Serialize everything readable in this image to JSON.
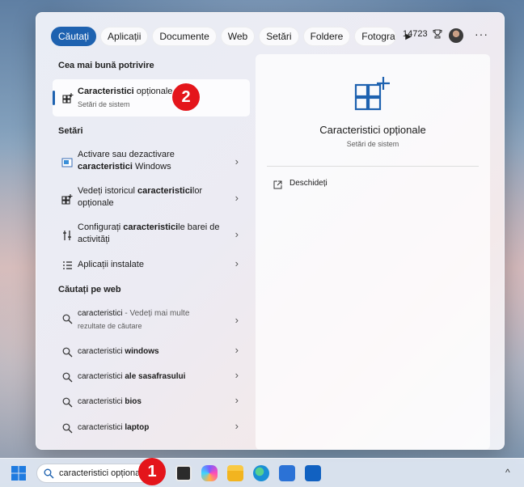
{
  "filters": {
    "tabs": [
      "Căutați",
      "Aplicații",
      "Documente",
      "Web",
      "Setări",
      "Foldere",
      "Fotograf"
    ],
    "points": "14723"
  },
  "best_match": {
    "header": "Cea mai bună potrivire",
    "title_bold": "Caracteristici",
    "title_rest": " opționale",
    "subtitle": "Setări de sistem"
  },
  "settings": {
    "header": "Setări",
    "items": [
      {
        "pre": "Activare sau dezactivare ",
        "bold": "caracteristici",
        "post": " Windows"
      },
      {
        "pre": "Vedeți istoricul ",
        "bold": "caracteristici",
        "post": "lor opționale"
      },
      {
        "pre": "Configurați ",
        "bold": "caracteristici",
        "post": "le barei de activități"
      },
      {
        "pre": "Aplicații instalate",
        "bold": "",
        "post": ""
      }
    ]
  },
  "web": {
    "header": "Căutați pe web",
    "items": [
      {
        "pre": "caracteristici",
        "bold": "",
        "post": " - Vedeți mai multe",
        "sub": "rezultate de căutare"
      },
      {
        "pre": "caracteristici ",
        "bold": "windows",
        "post": "",
        "sub": ""
      },
      {
        "pre": "caracteristici ",
        "bold": "ale sasafrasului",
        "post": "",
        "sub": ""
      },
      {
        "pre": "caracteristici ",
        "bold": "bios",
        "post": "",
        "sub": ""
      },
      {
        "pre": "caracteristici ",
        "bold": "laptop",
        "post": "",
        "sub": ""
      }
    ]
  },
  "preview": {
    "title": "Caracteristici opționale",
    "subtitle": "Setări de sistem",
    "open_label": "Deschideți"
  },
  "taskbar": {
    "search_value": "caracteristici opționale"
  },
  "badges": {
    "one": "1",
    "two": "2"
  },
  "colors": {
    "accent": "#1e62b0",
    "badge": "#e4151b"
  }
}
